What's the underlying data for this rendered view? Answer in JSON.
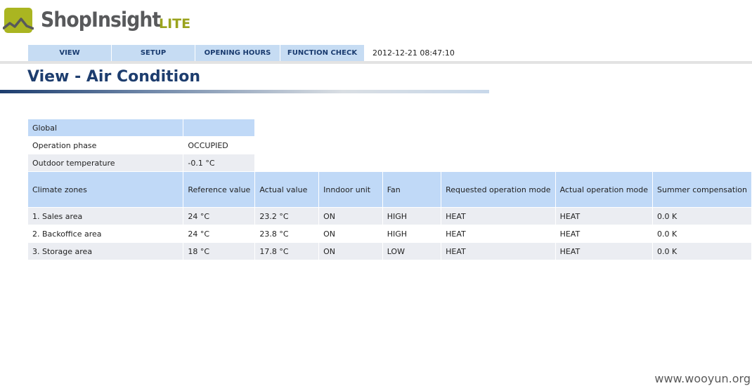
{
  "brand": {
    "name": "ShopInsight",
    "edition": "LITE",
    "colors": {
      "logo_green": "#aab521",
      "logo_grey": "#58595b",
      "title_blue": "#1d3d6e",
      "header_blue": "#c0d9f7"
    }
  },
  "nav": {
    "items": [
      {
        "label": "VIEW"
      },
      {
        "label": "SETUP"
      },
      {
        "label": "OPENING HOURS"
      },
      {
        "label": "FUNCTION CHECK"
      }
    ],
    "datetime": "2012-12-21 08:47:10"
  },
  "page": {
    "title": "View - Air Condition"
  },
  "global": {
    "header": "Global",
    "rows": [
      {
        "label": "Operation phase",
        "value": "OCCUPIED"
      },
      {
        "label": "Outdoor temperature",
        "value": "-0.1 °C"
      }
    ]
  },
  "zones": {
    "columns": [
      "Climate zones",
      "Reference value",
      "Actual value",
      "Inndoor unit",
      "Fan",
      "Requested operation mode",
      "Actual operation mode",
      "Summer compensation"
    ],
    "rows": [
      [
        "1. Sales area",
        "24 °C",
        "23.2 °C",
        "ON",
        "HIGH",
        "HEAT",
        "HEAT",
        "0.0 K"
      ],
      [
        "2. Backoffice area",
        "24 °C",
        "23.8 °C",
        "ON",
        "HIGH",
        "HEAT",
        "HEAT",
        "0.0 K"
      ],
      [
        "3. Storage area",
        "18 °C",
        "17.8 °C",
        "ON",
        "LOW",
        "HEAT",
        "HEAT",
        "0.0 K"
      ]
    ]
  },
  "watermark": "www.wooyun.org"
}
